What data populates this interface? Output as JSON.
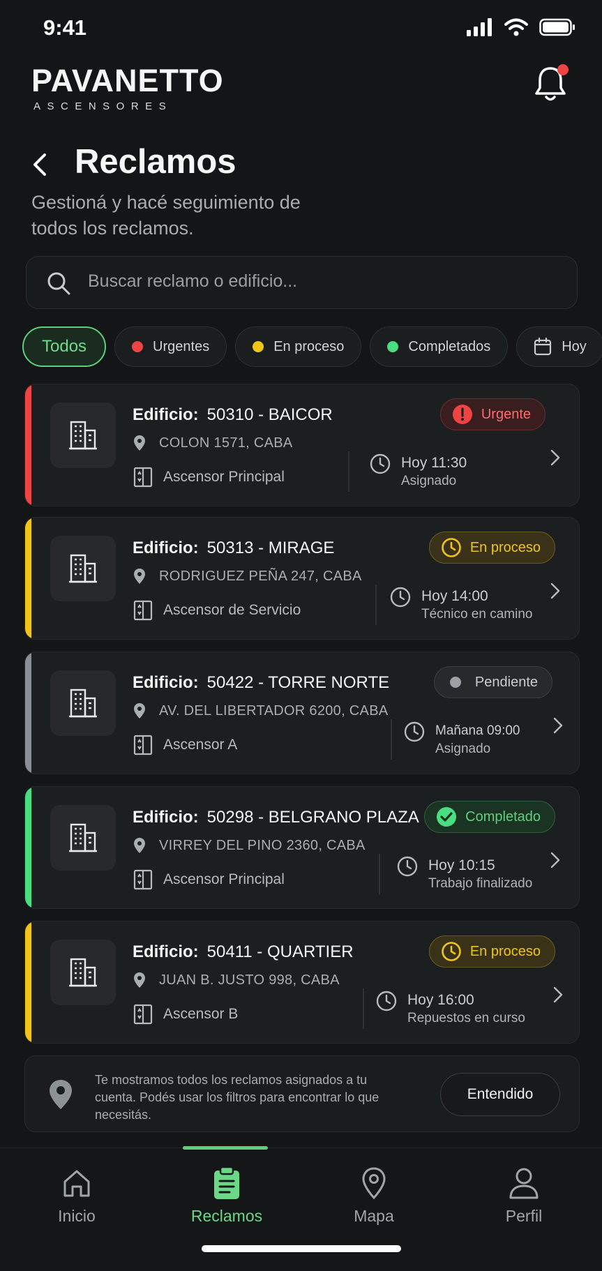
{
  "status_bar": {
    "time": "9:41"
  },
  "brand": {
    "name": "PAVANETTO",
    "subtitle": "ASCENSORES"
  },
  "header": {
    "title": "Reclamos",
    "subtitle": "Gestioná y hacé seguimiento de todos los reclamos."
  },
  "search": {
    "placeholder": "Buscar reclamo o edificio..."
  },
  "filters": [
    {
      "label": "Todos",
      "active": true
    },
    {
      "label": "Urgentes",
      "dot_color": "#ef4444"
    },
    {
      "label": "En proceso",
      "dot_color": "#f0c419"
    },
    {
      "label": "Completados",
      "dot_color": "#4ade80"
    },
    {
      "label": "Hoy",
      "icon": "calendar-icon"
    }
  ],
  "claims": [
    {
      "label": "Edificio:",
      "building": "50310 - BAICOR",
      "address": "COLON 1571, CABA",
      "elevator": "Ascensor Principal",
      "time": "Hoy 11:30",
      "status_detail": "Asignado",
      "badge": "Urgente",
      "badge_icon": "alert-icon",
      "accent": "#ef4444"
    },
    {
      "label": "Edificio:",
      "building": "50313 - MIRAGE",
      "address": "RODRIGUEZ PEÑA 247, CABA",
      "elevator": "Ascensor de Servicio",
      "time": "Hoy 14:00",
      "status_detail": "Técnico en camino",
      "badge": "En proceso",
      "badge_icon": "clock-icon",
      "accent": "#f0c419"
    },
    {
      "label": "Edificio:",
      "building": "50422 - TORRE NORTE",
      "address": "AV. DEL LIBERTADOR 6200, CABA",
      "elevator": "Ascensor A",
      "time": "Mañana 09:00",
      "status_detail": "Asignado",
      "badge": "Pendiente",
      "badge_icon": "dot-icon",
      "accent": "#8a8f96"
    },
    {
      "label": "Edificio:",
      "building": "50298 - BELGRANO PLAZA",
      "address": "VIRREY DEL PINO 2360, CABA",
      "elevator": "Ascensor Principal",
      "time": "Hoy 10:15",
      "status_detail": "Trabajo finalizado",
      "badge": "Completado",
      "badge_icon": "check-icon",
      "accent": "#4ade80"
    },
    {
      "label": "Edificio:",
      "building": "50411 - QUARTIER",
      "address": "JUAN B. JUSTO 998, CABA",
      "elevator": "Ascensor B",
      "time": "Hoy 16:00",
      "status_detail": "Repuestos en curso",
      "badge": "En proceso",
      "badge_icon": "clock-icon",
      "accent": "#f0c419"
    }
  ],
  "info": {
    "text": "Te mostramos todos los reclamos asignados a tu cuenta. Podés usar los filtros para encontrar lo que necesitás.",
    "button": "Entendido"
  },
  "tabs": [
    {
      "label": "Inicio",
      "icon": "home-icon"
    },
    {
      "label": "Reclamos",
      "icon": "clipboard-icon",
      "active": true
    },
    {
      "label": "Mapa",
      "icon": "map-pin-icon"
    },
    {
      "label": "Perfil",
      "icon": "user-icon"
    }
  ]
}
